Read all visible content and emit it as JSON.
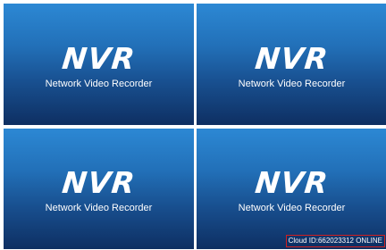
{
  "tiles": [
    {
      "logo": "NVR",
      "subtitle": "Network Video Recorder"
    },
    {
      "logo": "NVR",
      "subtitle": "Network Video Recorder"
    },
    {
      "logo": "NVR",
      "subtitle": "Network Video Recorder"
    },
    {
      "logo": "NVR",
      "subtitle": "Network Video Recorder"
    }
  ],
  "status": {
    "text": "Cloud ID:662023312 ONLINE"
  },
  "colors": {
    "tile_top": "#2c88d4",
    "tile_bottom": "#0e2f62",
    "status_border": "#d02020",
    "text": "#ffffff"
  }
}
